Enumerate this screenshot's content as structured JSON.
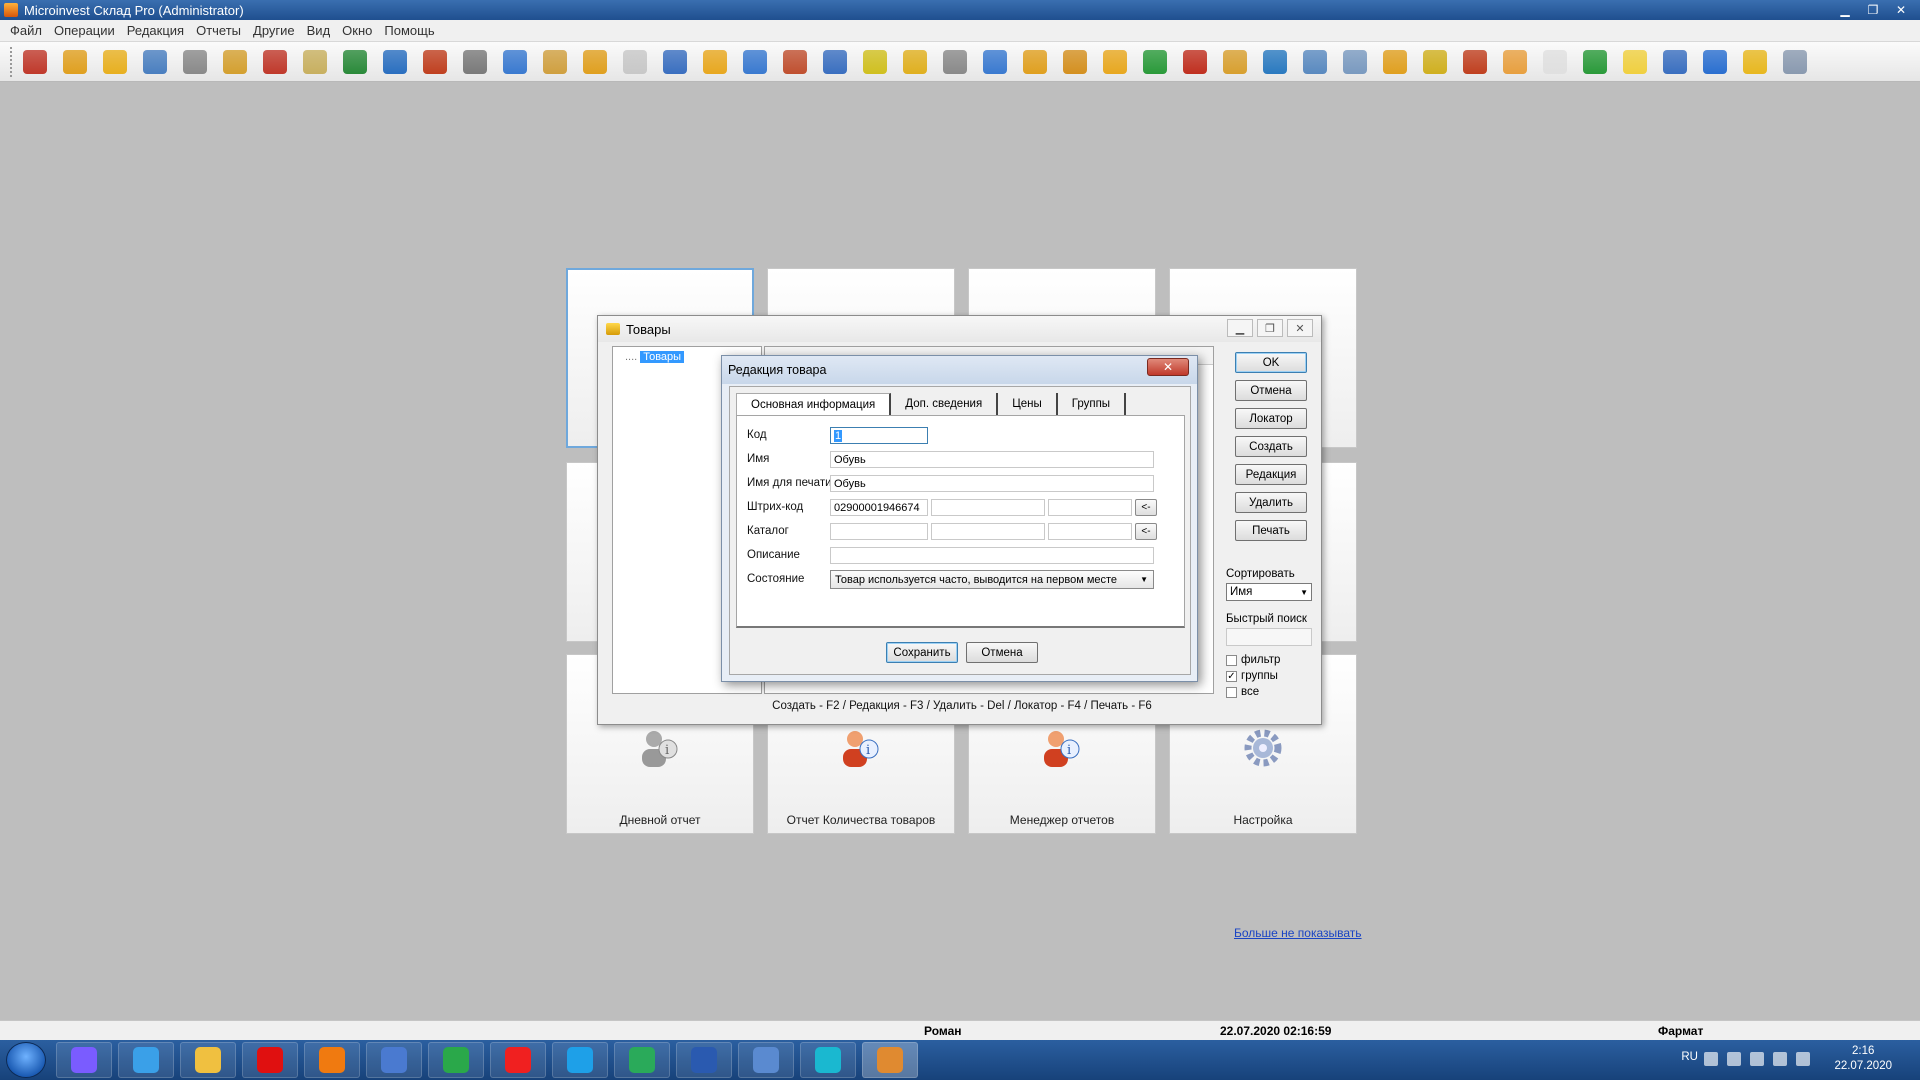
{
  "window": {
    "title": "Microinvest Склад Pro (Administrator)"
  },
  "menu": [
    "Файл",
    "Операции",
    "Редакция",
    "Отчеты",
    "Другие",
    "Вид",
    "Окно",
    "Помощь"
  ],
  "toolbar_icons": [
    {
      "name": "exit-icon",
      "color": "#c0392b"
    },
    {
      "name": "delivery-icon",
      "color": "#e0a020"
    },
    {
      "name": "sale-icon",
      "color": "#e8b020"
    },
    {
      "name": "tools-icon",
      "color": "#4a7fc0"
    },
    {
      "name": "cart-icon",
      "color": "#8a8a8a"
    },
    {
      "name": "box-icon",
      "color": "#d4a030"
    },
    {
      "name": "people-icon",
      "color": "#c0392b"
    },
    {
      "name": "document-icon",
      "color": "#c8b060"
    },
    {
      "name": "arrow-right-icon",
      "color": "#2a8a3a"
    },
    {
      "name": "ok-icon",
      "color": "#2a6fc0"
    },
    {
      "name": "arrow-left-icon",
      "color": "#c04020"
    },
    {
      "name": "trolley-icon",
      "color": "#7a7a7a"
    },
    {
      "name": "monitor-icon",
      "color": "#3a7ad0"
    },
    {
      "name": "clipboard-icon",
      "color": "#d0a040"
    },
    {
      "name": "book-icon",
      "color": "#e0a020"
    },
    {
      "name": "mail-icon",
      "color": "#c8c8c8"
    },
    {
      "name": "user-icon",
      "color": "#3a6fc0"
    },
    {
      "name": "package-icon",
      "color": "#e8a820"
    },
    {
      "name": "house-icon",
      "color": "#3a7ad0"
    },
    {
      "name": "users-icon",
      "color": "#c05030"
    },
    {
      "name": "pliers-icon",
      "color": "#3a6fc0"
    },
    {
      "name": "refresh-icon",
      "color": "#d0c020"
    },
    {
      "name": "coins-icon",
      "color": "#e0b020"
    },
    {
      "name": "wrench-icon",
      "color": "#8a8a8a"
    },
    {
      "name": "calendar-icon",
      "color": "#3a7ad0"
    },
    {
      "name": "box-in-icon",
      "color": "#e0a020"
    },
    {
      "name": "box-doc-icon",
      "color": "#d49020"
    },
    {
      "name": "box-add-icon",
      "color": "#e8a820"
    },
    {
      "name": "box-green-icon",
      "color": "#2a9a3a"
    },
    {
      "name": "recycle-icon",
      "color": "#c03020"
    },
    {
      "name": "doc-box-icon",
      "color": "#d8a030"
    },
    {
      "name": "doc-arrow-icon",
      "color": "#2a7ac0"
    },
    {
      "name": "tools2-icon",
      "color": "#5a8ac0"
    },
    {
      "name": "truck-icon",
      "color": "#7a9ac0"
    },
    {
      "name": "box-move-icon",
      "color": "#e0a020"
    },
    {
      "name": "box-tag-icon",
      "color": "#d0b020"
    },
    {
      "name": "report-icon",
      "color": "#c04020"
    },
    {
      "name": "person-doc-icon",
      "color": "#e8a040"
    },
    {
      "name": "blank-doc-icon",
      "color": "#e0e0e0"
    },
    {
      "name": "doc-in-icon",
      "color": "#2a9a3a"
    },
    {
      "name": "folder-icon",
      "color": "#f0d040"
    },
    {
      "name": "doc-check-icon",
      "color": "#3a6fc0"
    },
    {
      "name": "cash-register-icon",
      "color": "#2a6fd0"
    },
    {
      "name": "lock-icon",
      "color": "#e8b820"
    },
    {
      "name": "settings-icon",
      "color": "#8a9ab0"
    }
  ],
  "tiles": [
    {
      "label": "Дневной отчет",
      "icon": "person-info-gray-icon"
    },
    {
      "label": "Отчет Количества товаров",
      "icon": "person-info-icon"
    },
    {
      "label": "Менеджер отчетов",
      "icon": "person-info-icon"
    },
    {
      "label": "Настройка",
      "icon": "gear-icon"
    }
  ],
  "dont_show_link": "Больше не показывать",
  "products_window": {
    "title": "Товары",
    "tree_root": "Товары",
    "buttons": {
      "ok": "OK",
      "cancel": "Отмена",
      "locator": "Локатор",
      "create": "Создать",
      "edit": "Редакция",
      "delete": "Удалить",
      "print": "Печать"
    },
    "sort_label": "Сортировать",
    "sort_value": "Имя",
    "quick_search_label": "Быстрый поиск",
    "checks": [
      {
        "label": "фильтр",
        "checked": false
      },
      {
        "label": "группы",
        "checked": true
      },
      {
        "label": "все",
        "checked": false
      }
    ],
    "hint": "Создать - F2 / Редакция - F3 / Удалить - Del / Локатор - F4 / Печать - F6"
  },
  "edit_dialog": {
    "title": "Редакция товара",
    "close": "✕",
    "tabs": [
      "Основная информация",
      "Доп. сведения",
      "Цены",
      "Группы"
    ],
    "fields": {
      "code_label": "Код",
      "code_value": "1",
      "name_label": "Имя",
      "name_value": "Обувь",
      "print_name_label": "Имя для печати",
      "print_name_value": "Обувь",
      "barcode_label": "Штрих-код",
      "barcode_value": "02900001946674",
      "catalog_label": "Каталог",
      "description_label": "Описание",
      "state_label": "Состояние",
      "state_value": "Товар используется часто, выводится на первом месте"
    },
    "arrow_btn": "<-",
    "save": "Сохранить",
    "cancel": "Отмена"
  },
  "statusbar": {
    "user": "Роман",
    "datetime": "22.07.2020 02:16:59",
    "object": "Фармат"
  },
  "taskbar": {
    "apps": [
      {
        "name": "alice-icon",
        "color": "#7a5cff"
      },
      {
        "name": "ie-icon",
        "color": "#3aa0e8"
      },
      {
        "name": "explorer-icon",
        "color": "#f0c040"
      },
      {
        "name": "opera-icon",
        "color": "#e01010"
      },
      {
        "name": "media-icon",
        "color": "#f07a10"
      },
      {
        "name": "network-icon",
        "color": "#4a7ad0"
      },
      {
        "name": "chrome-icon",
        "color": "#2aa84a"
      },
      {
        "name": "yandex-icon",
        "color": "#f02020"
      },
      {
        "name": "skype-icon",
        "color": "#1ea0e8"
      },
      {
        "name": "vpn-icon",
        "color": "#2aaa5a"
      },
      {
        "name": "word-icon",
        "color": "#2a5ab0"
      },
      {
        "name": "remote-icon",
        "color": "#5a8ad0"
      },
      {
        "name": "viber-icon",
        "color": "#1ab8d0"
      },
      {
        "name": "microinvest-icon",
        "color": "#e08a30"
      }
    ],
    "lang": "RU",
    "time": "2:16",
    "date": "22.07.2020"
  }
}
